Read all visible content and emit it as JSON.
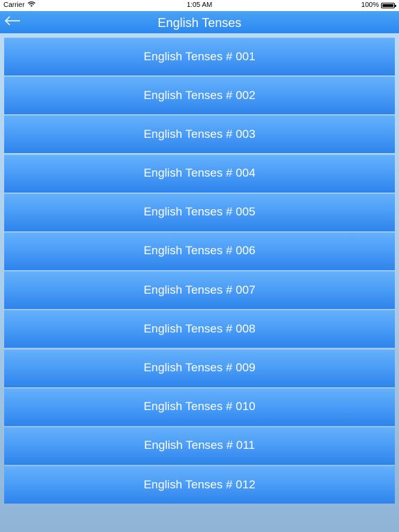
{
  "status_bar": {
    "carrier": "Carrier",
    "time": "1:05 AM",
    "battery": "100%",
    "battery_level": 1.0
  },
  "nav_bar": {
    "title": "English Tenses",
    "back_icon": "arrow-left-icon"
  },
  "list": {
    "items": [
      {
        "label": "English Tenses # 001"
      },
      {
        "label": "English Tenses # 002"
      },
      {
        "label": "English Tenses # 003"
      },
      {
        "label": "English Tenses # 004"
      },
      {
        "label": "English Tenses # 005"
      },
      {
        "label": "English Tenses # 006"
      },
      {
        "label": "English Tenses # 007"
      },
      {
        "label": "English Tenses # 008"
      },
      {
        "label": "English Tenses # 009"
      },
      {
        "label": "English Tenses # 010"
      },
      {
        "label": "English Tenses # 011"
      },
      {
        "label": "English Tenses # 012"
      }
    ]
  },
  "colors": {
    "nav_top": "#4aa3f5",
    "nav_bottom": "#2b87ef",
    "item_top": "#66b1fb",
    "item_bottom": "#2f84ec",
    "background": "#bcdcf4"
  }
}
